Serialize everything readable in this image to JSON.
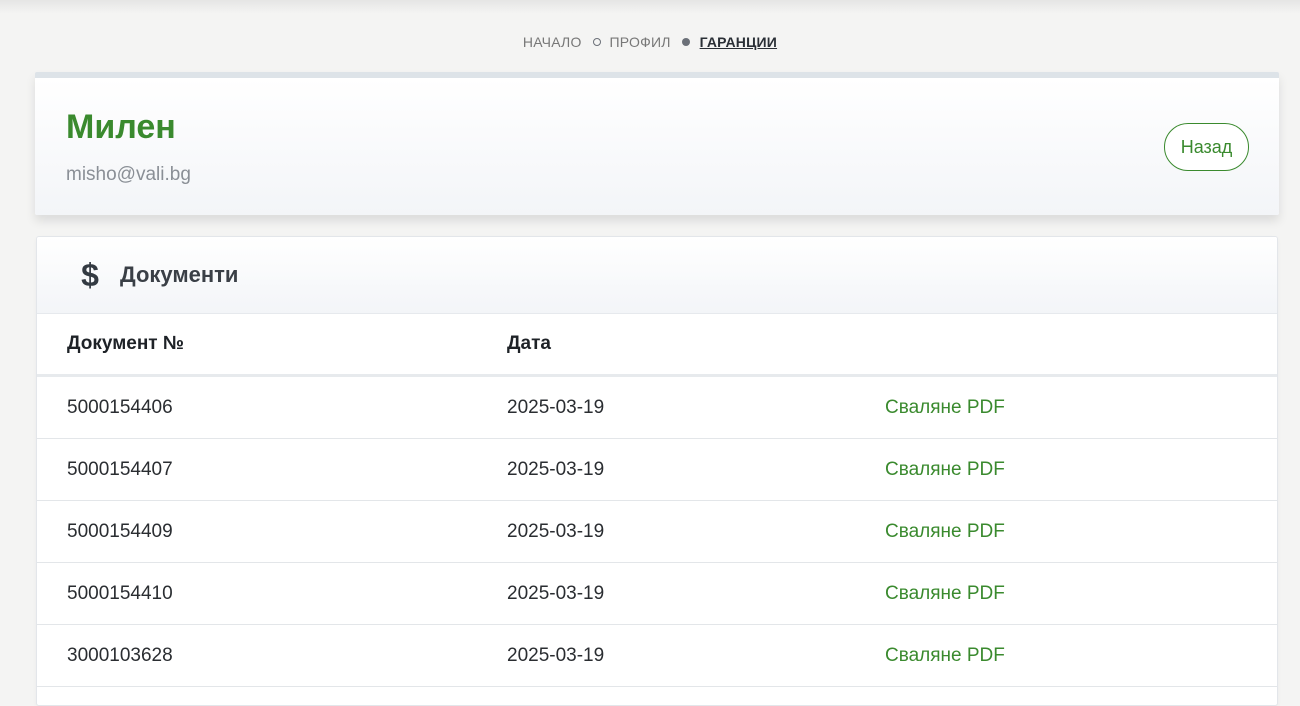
{
  "breadcrumb": {
    "items": [
      {
        "label": "НАЧАЛО"
      },
      {
        "label": "ПРОФИЛ"
      },
      {
        "label": "ГАРАНЦИИ"
      }
    ]
  },
  "profile": {
    "name": "Милен",
    "email": "misho@vali.bg",
    "back_label": "Назад"
  },
  "documents": {
    "icon": "dollar-icon",
    "icon_glyph": "$",
    "title": "Документи",
    "columns": {
      "doc_number": "Документ №",
      "date": "Дата"
    },
    "rows": [
      {
        "number": "5000154406",
        "date": "2025-03-19",
        "action": "Сваляне PDF"
      },
      {
        "number": "5000154407",
        "date": "2025-03-19",
        "action": "Сваляне PDF"
      },
      {
        "number": "5000154409",
        "date": "2025-03-19",
        "action": "Сваляне PDF"
      },
      {
        "number": "5000154410",
        "date": "2025-03-19",
        "action": "Сваляне PDF"
      },
      {
        "number": "3000103628",
        "date": "2025-03-19",
        "action": "Сваляне PDF"
      }
    ]
  },
  "colors": {
    "accent": "#3a8a2e",
    "text": "#2a2d31",
    "muted": "#8a8f96"
  }
}
